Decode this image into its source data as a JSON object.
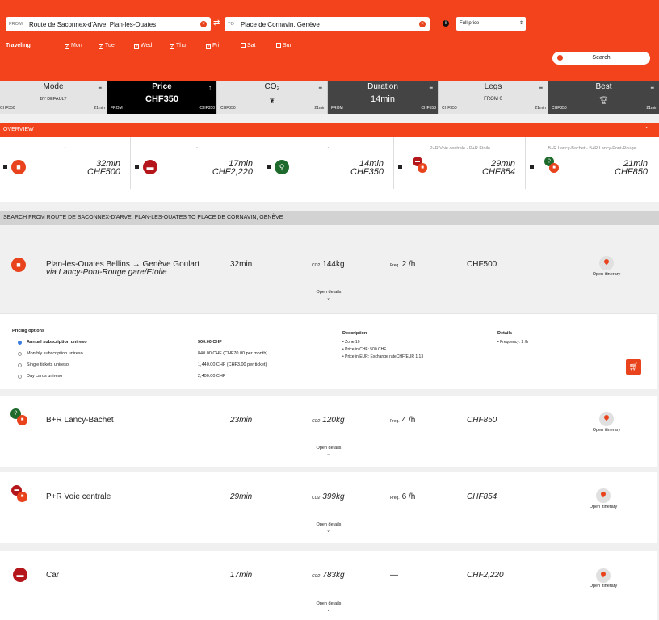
{
  "search": {
    "from_tag": "FROM",
    "from_value": "Route de Saconnex-d'Arve, Plan-les-Ouates",
    "to_tag": "TO",
    "to_value": "Place de Cornavin, Genève",
    "price_option": "Full price",
    "traveling_label": "Traveling",
    "days": [
      {
        "label": "Mon",
        "checked": true
      },
      {
        "label": "Tue",
        "checked": true
      },
      {
        "label": "Wed",
        "checked": true
      },
      {
        "label": "Thu",
        "checked": true
      },
      {
        "label": "Fri",
        "checked": true
      },
      {
        "label": "Sat",
        "checked": false
      },
      {
        "label": "Sun",
        "checked": false
      }
    ],
    "search_label": "Search"
  },
  "sort_tabs": [
    {
      "title": "Mode",
      "sub": "BY DEFAULT",
      "foot_left": "CHF350",
      "foot_right": "21min"
    },
    {
      "title": "Price",
      "sub": "CHF350",
      "foot_left": "FROM",
      "foot_right": "CHF350"
    },
    {
      "title": "CO₂",
      "sub": "",
      "foot_left": "CHF350",
      "foot_right": "21min"
    },
    {
      "title": "Duration",
      "sub": "14min",
      "foot_left": "FROM",
      "foot_right": "CHF553"
    },
    {
      "title": "Legs",
      "sub": "FROM  0",
      "foot_left": "CHF350",
      "foot_right": "21min"
    },
    {
      "title": "Best",
      "sub": "",
      "foot_left": "CHF350",
      "foot_right": "21min"
    }
  ],
  "overview": {
    "title": "OVERVIEW",
    "cards": [
      {
        "label": "-",
        "duration": "32min",
        "price": "CHF500"
      },
      {
        "label": "-",
        "duration": "17min",
        "price": "CHF2,220"
      },
      {
        "label": "-",
        "duration": "14min",
        "price": "CHF350"
      },
      {
        "label": "P+R Voie centrale - P+R Etoile",
        "duration": "29min",
        "price": "CHF854"
      },
      {
        "label": "B+R Lancy-Bachet - B+R Lancy-Pont-Rouge",
        "duration": "21min",
        "price": "CHF850"
      }
    ]
  },
  "search_header": "SEARCH FROM ROUTE DE SACONNEX-D'ARVE, PLAN-LES-OUATES TO PLACE DE CORNAVIN, GENÈVE",
  "labels": {
    "co2_unit": "CO2",
    "freq_unit": "Freq.",
    "open_itinerary": "Open itinerary",
    "open_details": "Open details"
  },
  "results": [
    {
      "name": "Plan-les-Ouates Bellins → Genève Goulart",
      "via": "via Lancy-Pont-Rouge gare/Etoile",
      "duration": "32min",
      "co2": "144kg",
      "freq": "2 /h",
      "price": "CHF500"
    },
    {
      "name": "B+R Lancy-Bachet",
      "duration": "23min",
      "co2": "120kg",
      "freq": "4 /h",
      "price": "CHF850"
    },
    {
      "name": "P+R Voie centrale",
      "duration": "29min",
      "co2": "399kg",
      "freq": "6 /h",
      "price": "CHF854"
    },
    {
      "name": "Car",
      "duration": "17min",
      "co2": "783kg",
      "freq": "—",
      "price": "CHF2,220"
    }
  ],
  "pricing": {
    "title": "Pricing options",
    "options": [
      {
        "label": "Annual subscription unireso",
        "value": "500.00 CHF",
        "selected": true
      },
      {
        "label": "Monthly subscription unireso",
        "value": "840.00 CHF (CHF70.00 per month)",
        "selected": false
      },
      {
        "label": "Single tickets unireso",
        "value": "1,440.00 CHF (CHF3.00 per ticket)",
        "selected": false
      },
      {
        "label": "Day cards unireso",
        "value": "2,400.00 CHF",
        "selected": false
      }
    ],
    "description_title": "Description",
    "description": [
      "Zone 10",
      "Price in CHF: 500 CHF",
      "Price in EUR: Exchange rateCHF/EUR 1.13"
    ],
    "details_title": "Details",
    "details": [
      "Frequency: 2 /h"
    ]
  },
  "colors": {
    "accent": "#f2431c",
    "dark_red": "#b5161b",
    "green": "#1e6a2c"
  }
}
